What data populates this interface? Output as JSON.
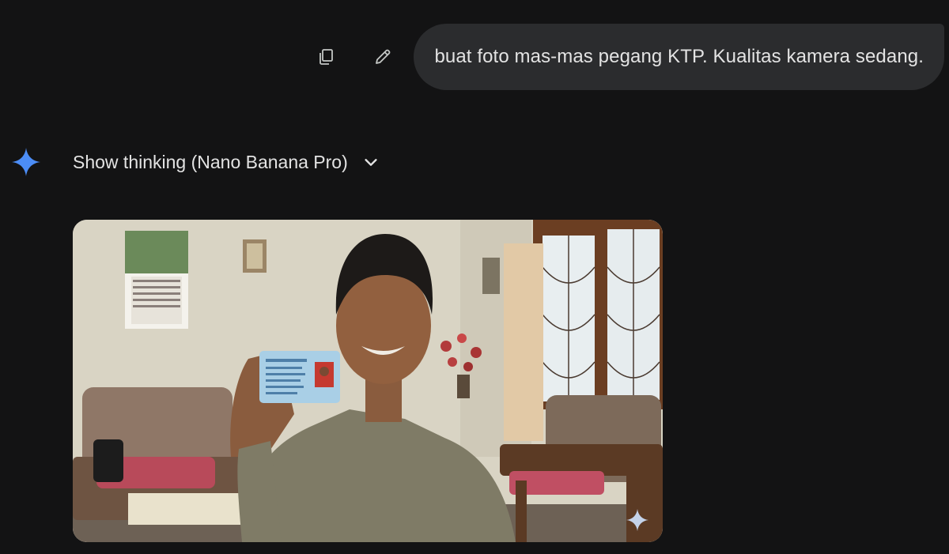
{
  "user_message": {
    "text": "buat foto mas-mas pegang KTP. Kualitas kamera sedang.",
    "actions": {
      "copy_icon": "copy-icon",
      "edit_icon": "pencil-icon"
    }
  },
  "response": {
    "model_icon": "gemini-spark-icon",
    "thinking_label": "Show thinking (Nano Banana Pro)",
    "toggle_icon": "chevron-down-icon",
    "image_watermark_icon": "sparkle-watermark-icon"
  },
  "colors": {
    "background": "#131314",
    "bubble": "#2b2c2e",
    "text": "#e3e3e3",
    "spark": "#4c8df6"
  }
}
